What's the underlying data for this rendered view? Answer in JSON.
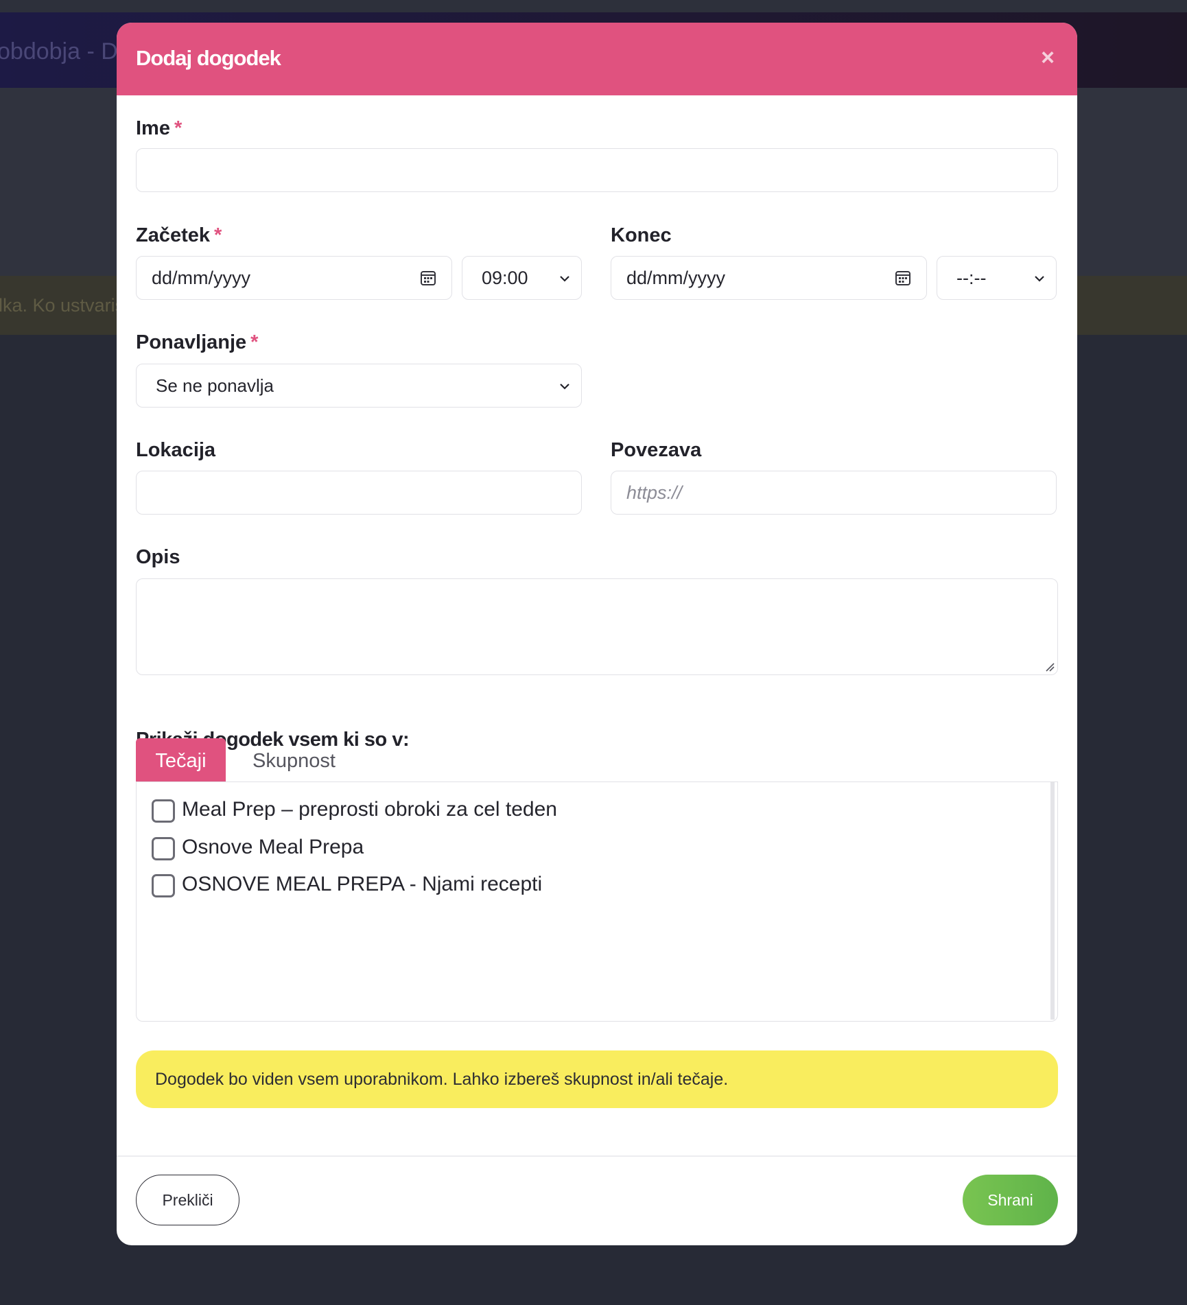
{
  "background": {
    "header_text": "obdobja - Do",
    "banner_text": "lka. Ko ustvariš"
  },
  "modal": {
    "title": "Dodaj dogodek",
    "close_icon": "close-icon"
  },
  "form": {
    "name": {
      "label": "Ime",
      "required_mark": "*",
      "value": ""
    },
    "start": {
      "label": "Začetek",
      "required_mark": "*",
      "date_placeholder": "dd/mm/yyyy",
      "time_value": "09:00"
    },
    "end": {
      "label": "Konec",
      "date_placeholder": "dd/mm/yyyy",
      "time_value": "--:--"
    },
    "repeat": {
      "label": "Ponavljanje",
      "required_mark": "*",
      "selected": "Se ne ponavlja"
    },
    "location": {
      "label": "Lokacija",
      "value": ""
    },
    "link": {
      "label": "Povezava",
      "placeholder": "https://"
    },
    "description": {
      "label": "Opis",
      "value": ""
    }
  },
  "visibility": {
    "label": "Prikaži dogodek vsem ki so v:",
    "tabs": [
      {
        "label": "Tečaji",
        "active": true
      },
      {
        "label": "Skupnost",
        "active": false
      }
    ],
    "courses": [
      {
        "label": "Meal Prep – preprosti obroki za cel teden",
        "checked": false
      },
      {
        "label": "Osnove Meal Prepa",
        "checked": false
      },
      {
        "label": "OSNOVE MEAL PREPA - Njami recepti",
        "checked": false
      }
    ]
  },
  "notice": {
    "text": "Dogodek bo viden vsem uporabnikom. Lahko izbereš skupnost in/ali tečaje."
  },
  "footer": {
    "cancel_label": "Prekliči",
    "save_label": "Shrani"
  },
  "colors": {
    "accent": "#e0527f",
    "save_green": "#6bbb4e",
    "notice_yellow": "#f9ed5e"
  }
}
